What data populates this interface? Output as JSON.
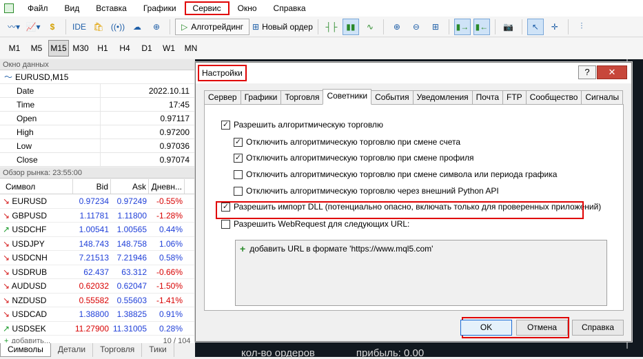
{
  "menu": {
    "items": [
      "Файл",
      "Вид",
      "Вставка",
      "Графики",
      "Сервис",
      "Окно",
      "Справка"
    ],
    "highlighted_index": 4
  },
  "toolbar": {
    "ide_label": "IDE",
    "algotrading_label": "Алготрейдинг",
    "new_order_label": "Новый ордер"
  },
  "timeframes": {
    "items": [
      "M1",
      "M5",
      "M15",
      "M30",
      "H1",
      "H4",
      "D1",
      "W1",
      "MN"
    ],
    "active_index": 2
  },
  "data_window": {
    "title": "Окно данных",
    "symbol": "EURUSD,M15",
    "rows": [
      {
        "key": "Date",
        "value": "2022.10.11"
      },
      {
        "key": "Time",
        "value": "17:45"
      },
      {
        "key": "Open",
        "value": "0.97117"
      },
      {
        "key": "High",
        "value": "0.97200"
      },
      {
        "key": "Low",
        "value": "0.97036"
      },
      {
        "key": "Close",
        "value": "0.97074"
      }
    ]
  },
  "market_watch": {
    "title": "Обзор рынка: 23:55:00",
    "columns": [
      "Символ",
      "Bid",
      "Ask",
      "Дневн..."
    ],
    "rows": [
      {
        "symbol": "EURUSD",
        "dir": "down",
        "bid": "0.97234",
        "ask": "0.97249",
        "change": "-0.55%",
        "bid_color": "blue",
        "change_color": "red"
      },
      {
        "symbol": "GBPUSD",
        "dir": "down",
        "bid": "1.11781",
        "ask": "1.11800",
        "change": "-1.28%",
        "bid_color": "blue",
        "change_color": "red"
      },
      {
        "symbol": "USDCHF",
        "dir": "up",
        "bid": "1.00541",
        "ask": "1.00565",
        "change": "0.44%",
        "bid_color": "blue",
        "change_color": "blue"
      },
      {
        "symbol": "USDJPY",
        "dir": "down",
        "bid": "148.743",
        "ask": "148.758",
        "change": "1.06%",
        "bid_color": "blue",
        "change_color": "blue"
      },
      {
        "symbol": "USDCNH",
        "dir": "down",
        "bid": "7.21513",
        "ask": "7.21946",
        "change": "0.58%",
        "bid_color": "blue",
        "change_color": "blue"
      },
      {
        "symbol": "USDRUB",
        "dir": "down",
        "bid": "62.437",
        "ask": "63.312",
        "change": "-0.66%",
        "bid_color": "blue",
        "change_color": "red"
      },
      {
        "symbol": "AUDUSD",
        "dir": "down",
        "bid": "0.62032",
        "ask": "0.62047",
        "change": "-1.50%",
        "bid_color": "red",
        "change_color": "red"
      },
      {
        "symbol": "NZDUSD",
        "dir": "down",
        "bid": "0.55582",
        "ask": "0.55603",
        "change": "-1.41%",
        "bid_color": "red",
        "change_color": "red"
      },
      {
        "symbol": "USDCAD",
        "dir": "down",
        "bid": "1.38800",
        "ask": "1.38825",
        "change": "0.91%",
        "bid_color": "blue",
        "change_color": "blue"
      },
      {
        "symbol": "USDSEK",
        "dir": "up",
        "bid": "11.27900",
        "ask": "11.31005",
        "change": "0.28%",
        "bid_color": "red",
        "change_color": "blue"
      }
    ],
    "add_label": "добавить...",
    "count": "10 / 104"
  },
  "bottom_tabs": [
    "Символы",
    "Детали",
    "Торговля",
    "Тики"
  ],
  "dialog": {
    "title": "Настройки",
    "help_btn": "?",
    "close_btn": "✕",
    "tabs": [
      "Сервер",
      "Графики",
      "Торговля",
      "Советники",
      "События",
      "Уведомления",
      "Почта",
      "FTP",
      "Сообщество",
      "Сигналы"
    ],
    "active_tab": 3,
    "options": [
      {
        "label": "Разрешить алгоритмическую торговлю",
        "checked": true,
        "indent": 0
      },
      {
        "label": "Отключить алгоритмическую торговлю при смене счета",
        "checked": true,
        "indent": 1
      },
      {
        "label": "Отключить алгоритмическую торговлю при смене профиля",
        "checked": true,
        "indent": 1
      },
      {
        "label": "Отключить алгоритмическую торговлю при смене символа или периода графика",
        "checked": false,
        "indent": 1
      },
      {
        "label": "Отключить алгоритмическую торговлю через внешний Python API",
        "checked": false,
        "indent": 1
      },
      {
        "label": "Разрешить импорт DLL (потенциально опасно, включать только для проверенных приложений)",
        "checked": true,
        "indent": 0
      },
      {
        "label": "Разрешить WebRequest для следующих URL:",
        "checked": false,
        "indent": 0
      }
    ],
    "url_add": "добавить URL в формате 'https://www.mql5.com'",
    "ok": "OK",
    "cancel": "Отмена",
    "help": "Справка"
  },
  "chart_text": {
    "orders": "кол-во ордеров",
    "profit": "прибыль: 0.00"
  }
}
